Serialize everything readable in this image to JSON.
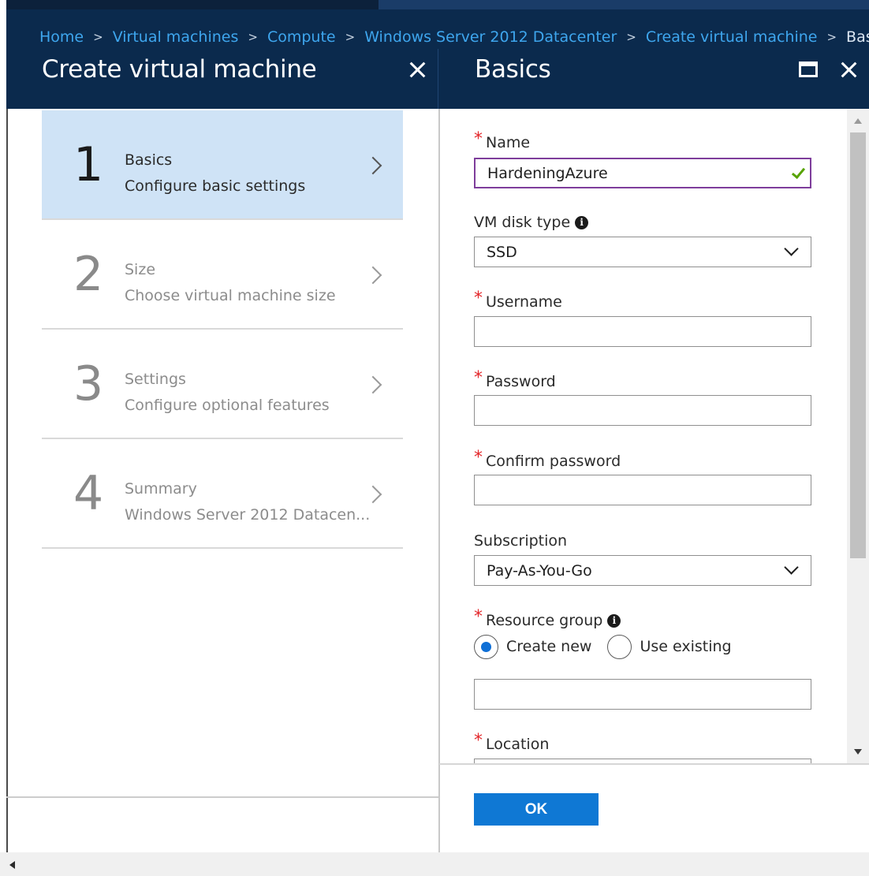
{
  "breadcrumb": {
    "items": [
      "Home",
      "Virtual machines",
      "Compute",
      "Windows Server 2012 Datacenter",
      "Create virtual machine"
    ],
    "current": "Basics",
    "separator": ">"
  },
  "left_blade": {
    "title": "Create virtual machine",
    "steps": [
      {
        "number": "1",
        "label": "Basics",
        "sub": "Configure basic settings",
        "active": true
      },
      {
        "number": "2",
        "label": "Size",
        "sub": "Choose virtual machine size",
        "active": false
      },
      {
        "number": "3",
        "label": "Settings",
        "sub": "Configure optional features",
        "active": false
      },
      {
        "number": "4",
        "label": "Summary",
        "sub": "Windows Server 2012 Datacen...",
        "active": false
      }
    ]
  },
  "right_blade": {
    "title": "Basics",
    "form": {
      "name": {
        "label": "Name",
        "required": true,
        "value": "HardeningAzure",
        "valid": true
      },
      "vm_disk_type": {
        "label": "VM disk type",
        "value": "SSD"
      },
      "username": {
        "label": "Username",
        "required": true,
        "value": ""
      },
      "password": {
        "label": "Password",
        "required": true,
        "value": ""
      },
      "confirm_password": {
        "label": "Confirm password",
        "required": true,
        "value": ""
      },
      "subscription": {
        "label": "Subscription",
        "value": "Pay-As-You-Go"
      },
      "resource_group": {
        "label": "Resource group",
        "required": true,
        "options": [
          "Create new",
          "Use existing"
        ],
        "selected": "Create new",
        "value": ""
      },
      "location": {
        "label": "Location",
        "required": true
      }
    },
    "ok_label": "OK"
  },
  "icons": {
    "close": "close-icon",
    "maximize": "maximize-icon",
    "info": "info-icon",
    "chevron_right": "chevron-right-icon",
    "chevron_down": "chevron-down-icon",
    "checkmark": "checkmark-icon"
  },
  "colors": {
    "header_bg": "#0b2a4d",
    "breadcrumb_link": "#3ea6ee",
    "active_step_bg": "#cfe3f6",
    "required": "#e3262a",
    "focus_border": "#7e3d9b",
    "valid_check": "#57a300",
    "primary_button": "#0f78d4"
  }
}
